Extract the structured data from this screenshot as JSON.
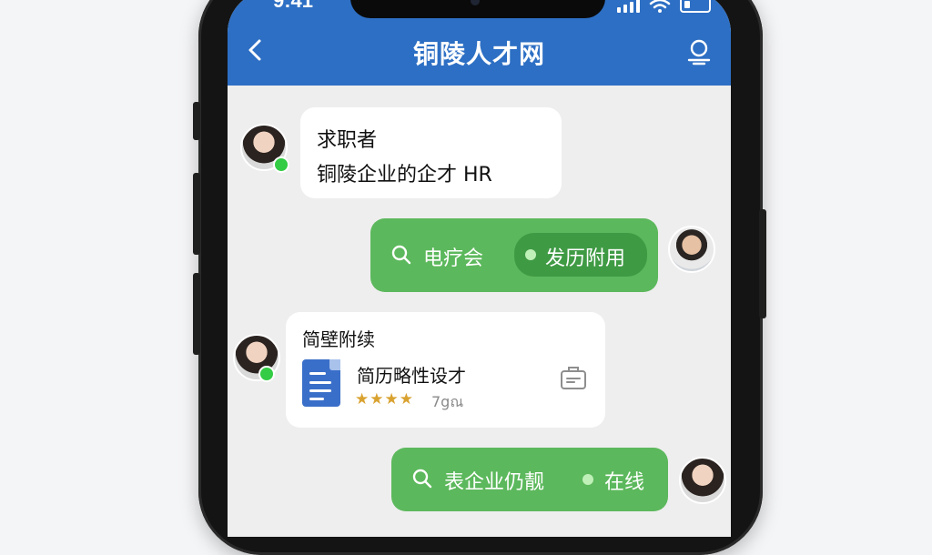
{
  "status_bar": {
    "time": "9:41"
  },
  "header": {
    "title": "铜陵人才网"
  },
  "messages": {
    "m1": {
      "line1": "求职者",
      "line2": "铜陵企业的企才 HR"
    },
    "m2": {
      "search_text": "电疗会",
      "pill_text": "发历附用"
    },
    "m3": {
      "heading": "简壁附续",
      "file_name": "简历略性设才",
      "stars": "★★★★",
      "count": "7gณ"
    },
    "m4": {
      "search_text": "表企业仍靓",
      "status_text": "在线"
    }
  },
  "colors": {
    "header": "#2d6fc4",
    "green_bubble": "#5cb85c",
    "online": "#33cc44"
  }
}
